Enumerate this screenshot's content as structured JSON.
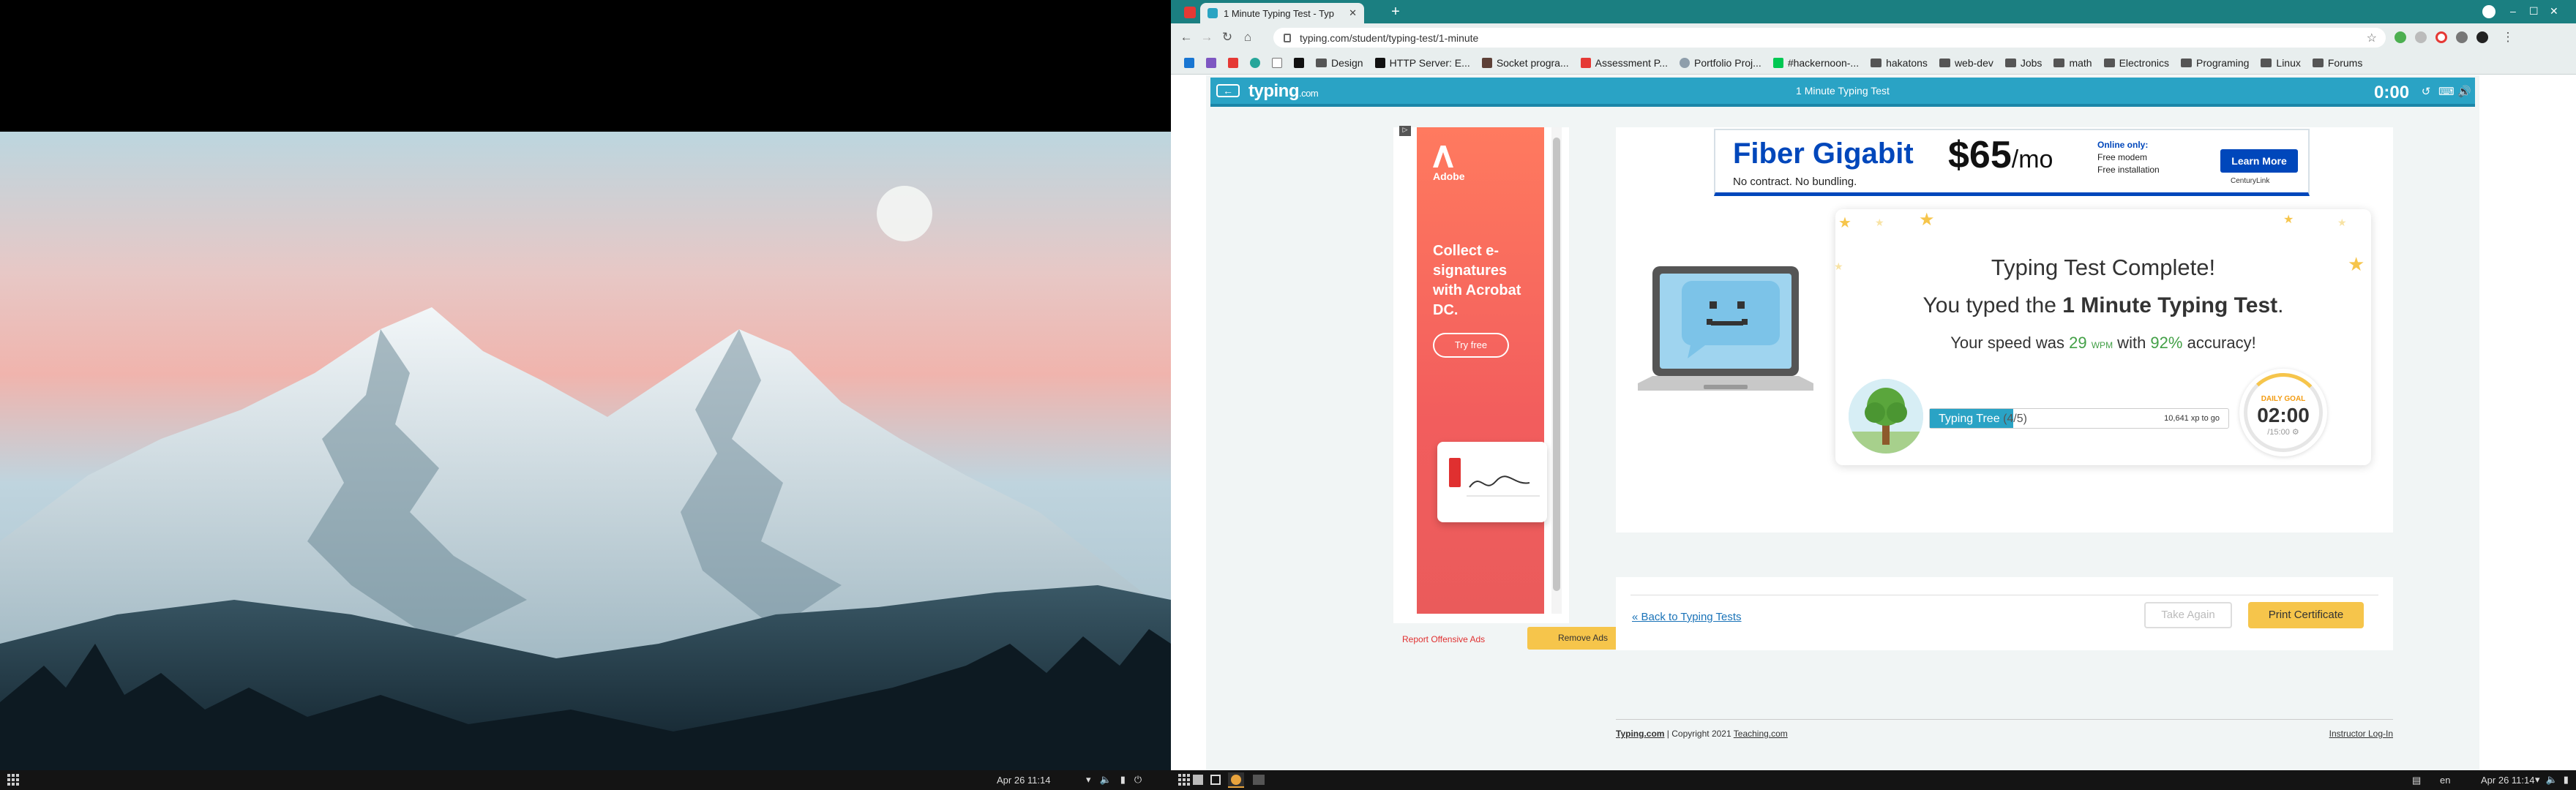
{
  "left_screen": {
    "clock": "Apr 26  11:14"
  },
  "browser": {
    "active_tab": "1 Minute Typing Test - Typ",
    "url": "typing.com/student/typing-test/1-minute",
    "bookmarks": [
      "Design",
      "HTTP Server: E...",
      "Socket progra...",
      "Assessment P...",
      "Portfolio Proj...",
      "#hackernoon-...",
      "hakatons",
      "web-dev",
      "Jobs",
      "math",
      "Electronics",
      "Programing",
      "Linux",
      "Forums"
    ]
  },
  "header": {
    "logo": "typing",
    "logo_suffix": ".com",
    "title": "1 Minute Typing Test",
    "timer": "0:00"
  },
  "ads": {
    "adobe_brand": "Adobe",
    "adobe_headline": "Collect e-signatures with Acrobat DC.",
    "adobe_cta": "Try free",
    "report": "Report Offensive Ads",
    "remove": "Remove Ads",
    "fiber_title": "Fiber Gigabit",
    "fiber_price": "$65",
    "fiber_per": "/mo",
    "fiber_online": "Online only:",
    "fiber_line1": "Free modem",
    "fiber_line2": "Free installation",
    "fiber_tagline": "No contract. No bundling.",
    "fiber_cta": "Learn More",
    "fiber_brand": "CenturyLink"
  },
  "result": {
    "title": "Typing Test Complete!",
    "sub_prefix": "You typed the ",
    "sub_test": "1 Minute Typing Test",
    "sub_suffix": ".",
    "speed_prefix": "Your speed was ",
    "wpm": "29",
    "wpm_unit": "WPM",
    "speed_mid": " with ",
    "accuracy": "92%",
    "speed_suffix": " accuracy!",
    "tree_label": "Typing Tree",
    "tree_stage": "(4/5)",
    "tree_xp": "10,641 xp to go",
    "tree_progress": 0.28,
    "daily_goal_label": "DAILY GOAL",
    "daily_time": "02:00",
    "daily_target": "/15:00",
    "daily_progress": 0.13
  },
  "actions": {
    "back": "« Back to Typing Tests",
    "take_again": "Take Again",
    "print": "Print Certificate"
  },
  "footer": {
    "brand": "Typing.com",
    "copyright": "| Copyright 2021",
    "teaching": "Teaching.com",
    "instructor": "Instructor Log-In"
  },
  "right_screen": {
    "clock": "Apr 26  11:14",
    "lang": "en"
  },
  "colors": {
    "brand": "#2aa3c5",
    "accent": "#f6c54b",
    "success": "#43a047",
    "chrome_tab_strip": "#1b7f81"
  }
}
